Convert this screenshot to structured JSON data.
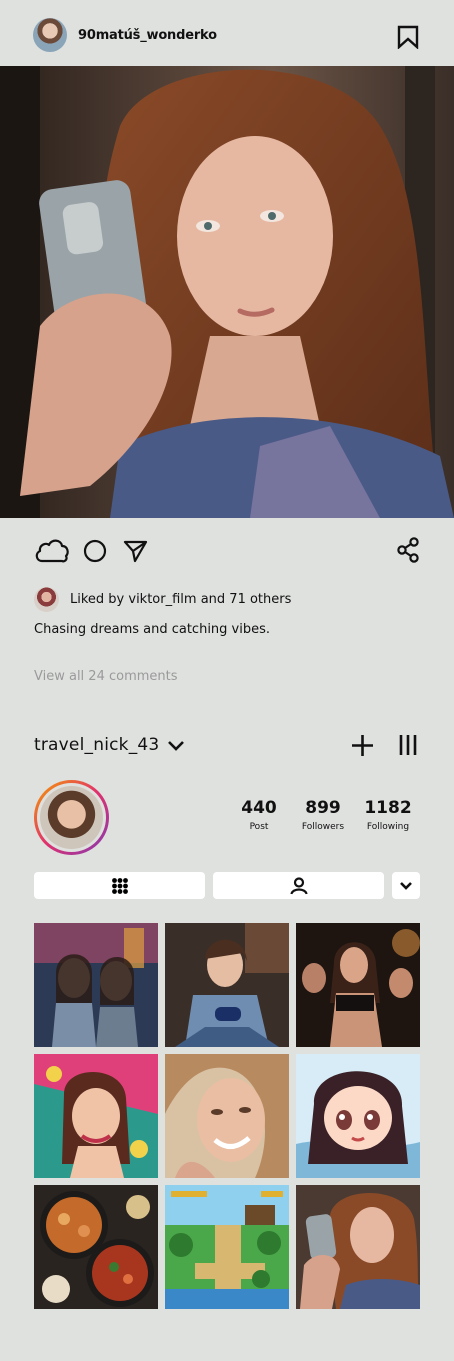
{
  "post": {
    "username": "90matúš_wonderko",
    "liked_by": "Liked by viktor_film and 71 others",
    "caption": "Chasing dreams and catching vibes.",
    "view_comments": "View all 24 comments"
  },
  "profile": {
    "username": "travel_nick_43",
    "stats": [
      {
        "value": "440",
        "label": "Post"
      },
      {
        "value": "899",
        "label": "Followers"
      },
      {
        "value": "1182",
        "label": "Following"
      }
    ]
  },
  "icons": {
    "bookmark": "bookmark-icon",
    "like": "cloud-like-icon",
    "comment": "circle-comment-icon",
    "share": "send-icon",
    "share_network": "share-icon",
    "dropdown": "chevron-down-icon",
    "add": "plus-icon",
    "menu": "menu-icon",
    "grid_tab": "grid-icon",
    "tagged_tab": "person-icon"
  },
  "grid_tiles": [
    "two girls looking at phones on neon street",
    "young woman with game controller",
    "women partying at night club",
    "cartoon woman with earrings",
    "smiling young woman close up",
    "anime girl portrait",
    "seafood paella dishes",
    "pixel art platformer level",
    "girl taking mirror selfie"
  ],
  "colors": {
    "background": "#dfe1df",
    "avatar_ring": "#e1306c",
    "muted_text": "#9a9a9a"
  }
}
